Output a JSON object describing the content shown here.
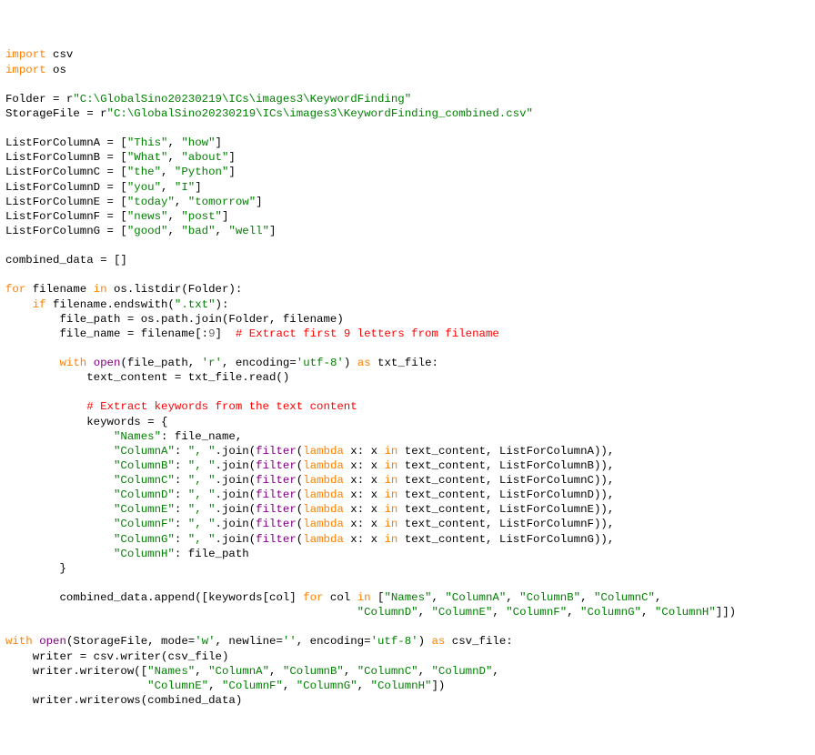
{
  "line01": {
    "kw": "import",
    "mod": " csv"
  },
  "line02": {
    "kw": "import",
    "mod": " os"
  },
  "line03": {
    "pre": "Folder = r",
    "str": "\"C:\\GlobalSino20230219\\ICs\\images3\\KeywordFinding\""
  },
  "line04": {
    "pre": "StorageFile = r",
    "str": "\"C:\\GlobalSino20230219\\ICs\\images3\\KeywordFinding_combined.csv\""
  },
  "line05": {
    "pre": "ListForColumnA = [",
    "s1": "\"This\"",
    "s2": "\"how\"",
    "post": "]"
  },
  "line06": {
    "pre": "ListForColumnB = [",
    "s1": "\"What\"",
    "s2": "\"about\"",
    "post": "]"
  },
  "line07": {
    "pre": "ListForColumnC = [",
    "s1": "\"the\"",
    "s2": "\"Python\"",
    "post": "]"
  },
  "line08": {
    "pre": "ListForColumnD = [",
    "s1": "\"you\"",
    "s2": "\"I\"",
    "post": "]"
  },
  "line09": {
    "pre": "ListForColumnE = [",
    "s1": "\"today\"",
    "s2": "\"tomorrow\"",
    "post": "]"
  },
  "line10": {
    "pre": "ListForColumnF = [",
    "s1": "\"news\"",
    "s2": "\"post\"",
    "post": "]"
  },
  "line11": {
    "pre": "ListForColumnG = [",
    "s1": "\"good\"",
    "s2": "\"bad\"",
    "s3": "\"well\"",
    "post": "]"
  },
  "line12": "combined_data = []",
  "line13": {
    "kw1": "for",
    "a": " filename ",
    "kw2": "in",
    "b": " os.listdir(Folder):"
  },
  "line14": {
    "indent": "    ",
    "kw": "if",
    "a": " filename.endswith(",
    "str": "\".txt\"",
    "b": "):"
  },
  "line15": {
    "indent": "        ",
    "text": "file_path = os.path.join(Folder, filename)"
  },
  "line16": {
    "indent": "        ",
    "a": "file_name = filename[:",
    "num": "9",
    "b": "]  ",
    "com": "# Extract first 9 letters from filename"
  },
  "line17": {
    "indent": "        ",
    "kw1": "with",
    "sp1": " ",
    "open": "open",
    "a": "(file_path, ",
    "s1": "'r'",
    "b": ", encoding=",
    "s2": "'utf-8'",
    "c": ") ",
    "kw2": "as",
    "d": " txt_file:"
  },
  "line18": {
    "indent": "            ",
    "text": "text_content = txt_file.read()"
  },
  "line19": {
    "indent": "            ",
    "com": "# Extract keywords from the text content"
  },
  "line20": {
    "indent": "            ",
    "text": "keywords = {"
  },
  "line21": {
    "indent": "                ",
    "s": "\"Names\"",
    "rest": ": file_name,"
  },
  "line22": {
    "indent": "                ",
    "k": "\"ColumnA\"",
    "a": ": ",
    "s1": "\", \"",
    "b": ".join(",
    "purple": "filter",
    "c": "(",
    "kw": "lambda",
    "d": " x: x ",
    "kw2": "in",
    "e": " text_content, ListForColumnA)),"
  },
  "line23": {
    "indent": "                ",
    "k": "\"ColumnB\"",
    "a": ": ",
    "s1": "\", \"",
    "b": ".join(",
    "purple": "filter",
    "c": "(",
    "kw": "lambda",
    "d": " x: x ",
    "kw2": "in",
    "e": " text_content, ListForColumnB)),"
  },
  "line24": {
    "indent": "                ",
    "k": "\"ColumnC\"",
    "a": ": ",
    "s1": "\", \"",
    "b": ".join(",
    "purple": "filter",
    "c": "(",
    "kw": "lambda",
    "d": " x: x ",
    "kw2": "in",
    "e": " text_content, ListForColumnC)),"
  },
  "line25": {
    "indent": "                ",
    "k": "\"ColumnD\"",
    "a": ": ",
    "s1": "\", \"",
    "b": ".join(",
    "purple": "filter",
    "c": "(",
    "kw": "lambda",
    "d": " x: x ",
    "kw2": "in",
    "e": " text_content, ListForColumnD)),"
  },
  "line26": {
    "indent": "                ",
    "k": "\"ColumnE\"",
    "a": ": ",
    "s1": "\", \"",
    "b": ".join(",
    "purple": "filter",
    "c": "(",
    "kw": "lambda",
    "d": " x: x ",
    "kw2": "in",
    "e": " text_content, ListForColumnE)),"
  },
  "line27": {
    "indent": "                ",
    "k": "\"ColumnF\"",
    "a": ": ",
    "s1": "\", \"",
    "b": ".join(",
    "purple": "filter",
    "c": "(",
    "kw": "lambda",
    "d": " x: x ",
    "kw2": "in",
    "e": " text_content, ListForColumnF)),"
  },
  "line28": {
    "indent": "                ",
    "k": "\"ColumnG\"",
    "a": ": ",
    "s1": "\", \"",
    "b": ".join(",
    "purple": "filter",
    "c": "(",
    "kw": "lambda",
    "d": " x: x ",
    "kw2": "in",
    "e": " text_content, ListForColumnG)),"
  },
  "line29": {
    "indent": "                ",
    "s": "\"ColumnH\"",
    "rest": ": file_path"
  },
  "line30": {
    "indent": "        ",
    "text": "}"
  },
  "line31": {
    "indent": "        ",
    "a": "combined_data.append([keywords[col] ",
    "kw1": "for",
    "b": " col ",
    "kw2": "in",
    "c": " [",
    "s1": "\"Names\"",
    "s2": "\"ColumnA\"",
    "s3": "\"ColumnB\"",
    "s4": "\"ColumnC\"",
    "tail": ","
  },
  "line32": {
    "indent": "                                                    ",
    "s5": "\"ColumnD\"",
    "s6": "\"ColumnE\"",
    "s7": "\"ColumnF\"",
    "s8": "\"ColumnG\"",
    "s9": "\"ColumnH\"",
    "tail": "]])"
  },
  "line33": {
    "kw1": "with",
    "sp": " ",
    "open": "open",
    "a": "(StorageFile, mode=",
    "s1": "'w'",
    "b": ", newline=",
    "s2": "''",
    "c": ", encoding=",
    "s3": "'utf-8'",
    "d": ") ",
    "kw2": "as",
    "e": " csv_file:"
  },
  "line34": {
    "indent": "    ",
    "text": "writer = csv.writer(csv_file)"
  },
  "line35": {
    "indent": "    ",
    "a": "writer.writerow([",
    "s1": "\"Names\"",
    "s2": "\"ColumnA\"",
    "s3": "\"ColumnB\"",
    "s4": "\"ColumnC\"",
    "s5": "\"ColumnD\"",
    "tail": ","
  },
  "line36": {
    "indent": "                     ",
    "s6": "\"ColumnE\"",
    "s7": "\"ColumnF\"",
    "s8": "\"ColumnG\"",
    "s9": "\"ColumnH\"",
    "tail": "])"
  },
  "line37": {
    "indent": "    ",
    "text": "writer.writerows(combined_data)"
  }
}
